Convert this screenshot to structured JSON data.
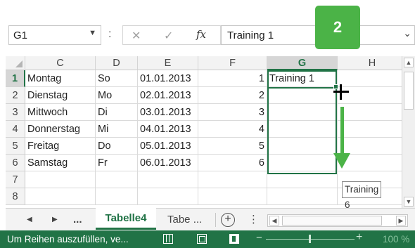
{
  "formula_bar": {
    "name_box": "G1",
    "separator": ":",
    "cancel_glyph": "✕",
    "enter_glyph": "✓",
    "fx_label": "fx",
    "formula_value": "Training 1"
  },
  "callout": {
    "step": "2"
  },
  "columns": [
    "C",
    "D",
    "E",
    "F",
    "G",
    "H"
  ],
  "selected_column": "G",
  "rows": [
    {
      "num": "1",
      "C": "Montag",
      "D": "So",
      "E": "01.01.2013",
      "F": "1",
      "G": "Training 1"
    },
    {
      "num": "2",
      "C": "Dienstag",
      "D": "Mo",
      "E": "02.01.2013",
      "F": "2",
      "G": ""
    },
    {
      "num": "3",
      "C": "Mittwoch",
      "D": "Di",
      "E": "03.01.2013",
      "F": "3",
      "G": ""
    },
    {
      "num": "4",
      "C": "Donnerstag",
      "D": "Mi",
      "E": "04.01.2013",
      "F": "4",
      "G": ""
    },
    {
      "num": "5",
      "C": "Freitag",
      "D": "Do",
      "E": "05.01.2013",
      "F": "5",
      "G": ""
    },
    {
      "num": "6",
      "C": "Samstag",
      "D": "Fr",
      "E": "06.01.2013",
      "F": "6",
      "G": ""
    },
    {
      "num": "7",
      "C": "",
      "D": "",
      "E": "",
      "F": "",
      "G": ""
    },
    {
      "num": "8",
      "C": "",
      "D": "",
      "E": "",
      "F": "",
      "G": ""
    }
  ],
  "fill_tooltip": "Training 6",
  "sheet_tabs": {
    "prev": "◀",
    "next": "▶",
    "more_left": "...",
    "active": "Tabelle4",
    "other": "Tabe ...",
    "add": "+",
    "more_right": "⋮"
  },
  "status": {
    "text": "Um Reihen auszufüllen, ve...",
    "zoom": "100 %"
  },
  "colors": {
    "excel_green": "#217346",
    "callout_green": "#4bb347"
  }
}
